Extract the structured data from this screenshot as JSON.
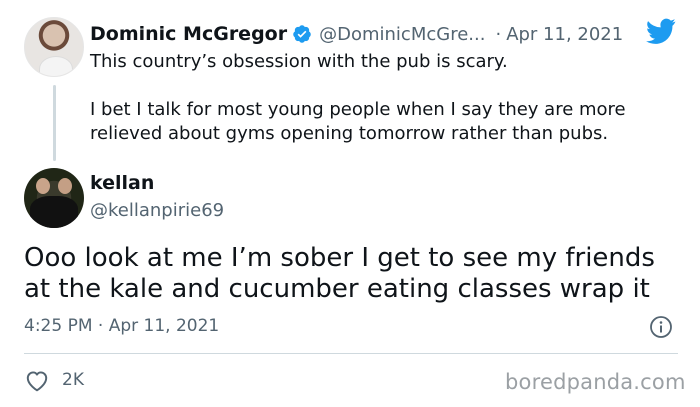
{
  "original_tweet": {
    "author_name": "Dominic McGregor",
    "handle": "@DominicMcGre...",
    "separator": "·",
    "date": "Apr 11, 2021",
    "paragraphs": [
      "This country’s obsession with the pub is scary.",
      "I bet I talk for most young people when I say they are more relieved about gyms opening tomorrow rather than pubs."
    ]
  },
  "reply_tweet": {
    "author_name": "kellan",
    "handle": "@kellanpirie69",
    "text": "Ooo look at me I’m sober I get to see my friends at the kale and cucumber eating classes wrap it",
    "timestamp": "4:25 PM · Apr 11, 2021",
    "like_count": "2K"
  },
  "watermark": "boredpanda.com",
  "colors": {
    "twitter_blue": "#1d9bf0",
    "secondary_text": "#536471",
    "primary_text": "#0f1419",
    "divider": "#cfd9de"
  },
  "icons": {
    "verified": "verified-badge-icon",
    "brand": "twitter-bird-icon",
    "info": "info-icon",
    "like": "heart-icon"
  }
}
